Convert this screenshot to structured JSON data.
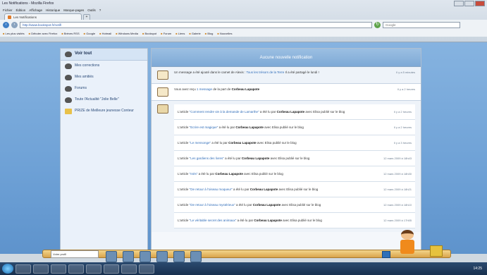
{
  "browser": {
    "title": "Les Notifications - Mozilla Firefox",
    "menu": [
      "Fichier",
      "Édition",
      "Affichage",
      "Historique",
      "Marque-pages",
      "Outils",
      "?"
    ],
    "tab_label": "Les Notifications",
    "url": "http://www.bookspot.fr/notif/",
    "search_placeholder": "Google",
    "bookmarks": [
      "Les plus visités",
      "Débuter avec Firefox",
      "Brèves RSS",
      "Google",
      "Hotmail",
      "Windows Media",
      "Bookspot",
      "Forum",
      "Liens",
      "Galerie",
      "Blog",
      "Nouvelles"
    ]
  },
  "sidebar": {
    "items": [
      {
        "label": "Voir tout",
        "active": true,
        "icon": "eye-icon"
      },
      {
        "label": "Mes corrections",
        "icon": "book-icon"
      },
      {
        "label": "Mes amitiés",
        "icon": "friends-icon"
      },
      {
        "label": "Forums",
        "icon": "forum-icon"
      },
      {
        "label": "Toute l'Actualité \"Jolie Belle\"",
        "icon": "news-icon"
      },
      {
        "label": "PRIZE de Meilleure jeunesse Conteur",
        "icon": "trophy-icon"
      }
    ]
  },
  "main": {
    "header": "Aucune nouvelle notification",
    "notifications": [
      {
        "pre": "Un message a été ajouté dans le carnet de Alexis : ",
        "link": "Tous les trésors de la Terre",
        "post": " Il a été partagé le lundi !",
        "time": "Il y a 5 minutes"
      },
      {
        "pre": "Vous avez reçu ",
        "link": "1 message",
        "post": " de la part de ",
        "bold": "Corbeau Lapapote",
        "time": "Il y a 2 heures"
      }
    ],
    "group_items": [
      {
        "pre": "L'article ",
        "link": "\"Comment rendre vie à la demande de Lamarthe\"",
        "post": " a été lu par ",
        "bold": "Corbeau Lapapote",
        "tail": " avec Elisa publié sur le blog",
        "time": "Il y a 2 heures"
      },
      {
        "pre": "L'article ",
        "link": "\"Ecrire est magique\"",
        "post": " a été lu par ",
        "bold": "Corbeau Lapapote",
        "tail": " avec Elisa publié sur le blog",
        "time": "Il y a 2 heures"
      },
      {
        "pre": "L'article ",
        "link": "\"Le mensonge\"",
        "post": " a été lu par ",
        "bold": "Corbeau Lapapote",
        "tail": " avec Elisa publié sur le blog",
        "time": "Il y a 3 heures"
      },
      {
        "pre": "L'article ",
        "link": "\"Les gardiens des livres\"",
        "post": " a été lu par ",
        "bold": "Corbeau Lapapote",
        "tail": " avec Elisa publié sur le blog",
        "time": "12 mars 2009 à 18h43"
      },
      {
        "pre": "L'article ",
        "link": "\"Inès\"",
        "post": " a été lu par ",
        "bold": "Corbeau Lapapote",
        "tail": " avec Elisa publié sur le blog",
        "time": "12 mars 2009 à 18h30"
      },
      {
        "pre": "L'article ",
        "link": "\"De retour à l'oiseau moqueur\"",
        "post": " a été lu par ",
        "bold": "Corbeau Lapapote",
        "tail": " avec Elisa publié sur le blog",
        "time": "12 mars 2009 à 18h21"
      },
      {
        "pre": "L'article ",
        "link": "\"De retour à l'oiseau mystérieux\"",
        "post": " a été lu par ",
        "bold": "Corbeau Lapapote",
        "tail": " avec Elisa publié sur le blog",
        "time": "12 mars 2009 à 18h10"
      },
      {
        "pre": "L'article ",
        "link": "\"Le véritable secret des animaux\"",
        "post": " a été lu par ",
        "bold": "Corbeau Lapapote",
        "tail": " avec Elisa publié sur le blog",
        "time": "12 mars 2009 à 17h55"
      }
    ]
  },
  "dock": {
    "user_label": "Votre profil"
  },
  "taskbar": {
    "clock": "14:25"
  },
  "colors": {
    "page_bg": "#6ea1d6",
    "link": "#2f6cb8",
    "accent": "#f08a1c"
  }
}
